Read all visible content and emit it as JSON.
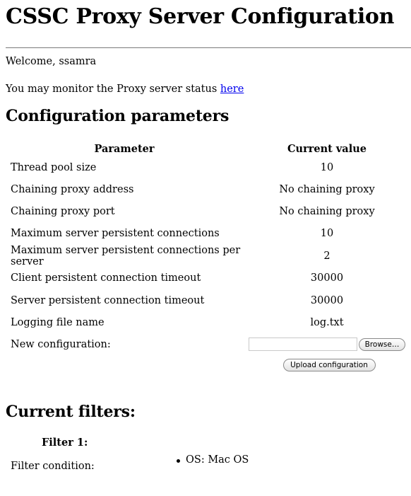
{
  "page": {
    "title": "CSSC Proxy Server Configuration",
    "welcome": "Welcome, ssamra",
    "monitor_text": "You may monitor the Proxy server status ",
    "monitor_link": "here"
  },
  "config": {
    "heading": "Configuration parameters",
    "headers": {
      "parameter": "Parameter",
      "value": "Current value"
    },
    "rows": [
      {
        "parameter": "Thread pool size",
        "value": "10"
      },
      {
        "parameter": "Chaining proxy address",
        "value": "No chaining proxy"
      },
      {
        "parameter": "Chaining proxy port",
        "value": "No chaining proxy"
      },
      {
        "parameter": "Maximum server persistent connections",
        "value": "10"
      },
      {
        "parameter": "Maximum server persistent connections per server",
        "value": "2"
      },
      {
        "parameter": "Client persistent connection timeout",
        "value": "30000"
      },
      {
        "parameter": "Server persistent connection timeout",
        "value": "30000"
      },
      {
        "parameter": "Logging file name",
        "value": "log.txt"
      }
    ],
    "new_config_label": "New configuration:",
    "file_input_value": "",
    "browse_label": "Browse…",
    "upload_label": "Upload configuration"
  },
  "filters": {
    "heading": "Current filters:",
    "items": [
      {
        "title": "Filter 1:",
        "condition_label": "Filter condition:",
        "conditions": [
          "OS: Mac OS"
        ]
      }
    ]
  }
}
